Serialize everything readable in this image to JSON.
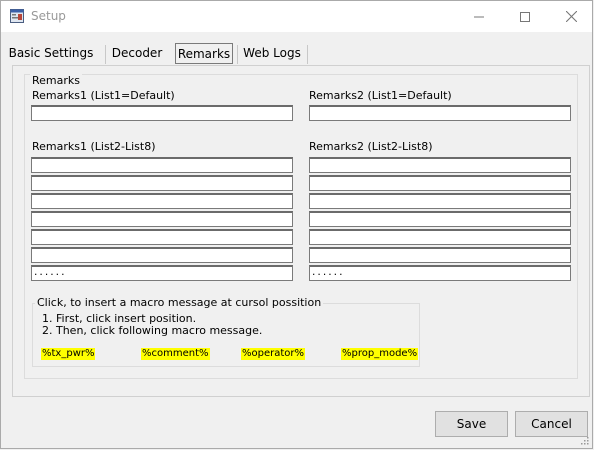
{
  "window": {
    "title": "Setup"
  },
  "tabs": [
    {
      "label": "Basic Settings"
    },
    {
      "label": "Decoder"
    },
    {
      "label": "Remarks"
    },
    {
      "label": "Web Logs"
    }
  ],
  "remarks": {
    "group_label": "Remarks",
    "r1_default_label": "Remarks1 (List1=Default)",
    "r2_default_label": "Remarks2 (List1=Default)",
    "r1_list_label": "Remarks1 (List2-List8)",
    "r2_list_label": "Remarks2 (List2-List8)",
    "r1_default_value": "",
    "r2_default_value": "",
    "r1_list_values": [
      "",
      "",
      "",
      "",
      "",
      "",
      "......"
    ],
    "r2_list_values": [
      "",
      "",
      "",
      "",
      "",
      "",
      "......"
    ]
  },
  "macro": {
    "group_label": "Click, to insert a macro message at cursol possition",
    "step1": "1. First, click insert position.",
    "step2": "2. Then, click following macro message.",
    "tags": [
      "%tx_pwr%",
      "%comment%",
      "%operator%",
      "%prop_mode%"
    ],
    "highlight_color": "#ffff00"
  },
  "buttons": {
    "save": "Save",
    "cancel": "Cancel"
  }
}
